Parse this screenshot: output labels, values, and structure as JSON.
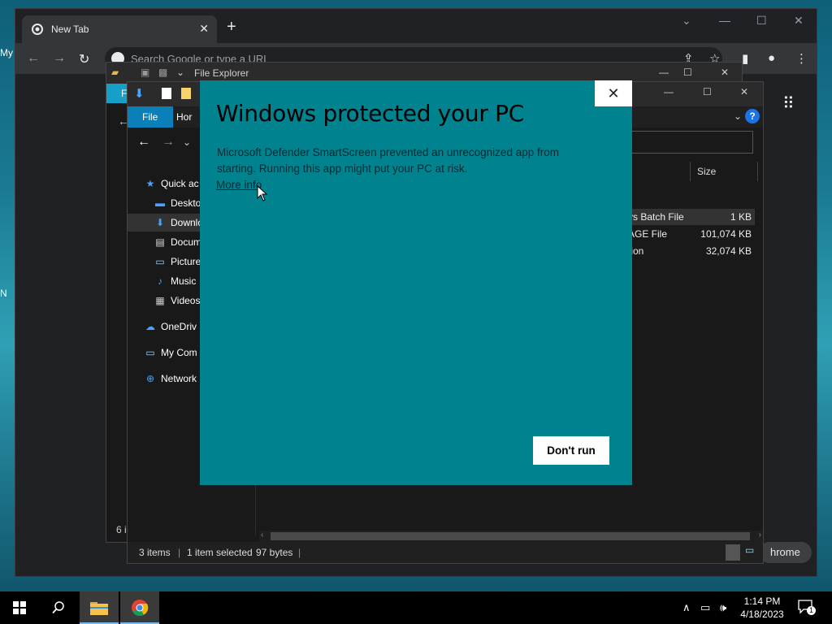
{
  "desktop": {
    "fragments": [
      "My",
      "N"
    ]
  },
  "chrome": {
    "tab_title": "New Tab",
    "tab_close": "✕",
    "new_tab": "+",
    "minimize": "—",
    "maximize": "☐",
    "close": "✕",
    "omnibox_placeholder": "Search Google or type a URL",
    "apps_label": "Apps",
    "bottom_button": "hrome"
  },
  "explorer_back": {
    "title": "File Explorer",
    "ribbon_tab": "F",
    "status": "6 i"
  },
  "explorer": {
    "ribbon_file": "File",
    "ribbon_home": "Hor",
    "help": "?",
    "sidebar": [
      {
        "label": "Quick ac",
        "icon": "star-icon"
      },
      {
        "label": "Deskto",
        "icon": "desktop-folder-icon"
      },
      {
        "label": "Downlo",
        "icon": "downloads-icon"
      },
      {
        "label": "Docum",
        "icon": "documents-icon"
      },
      {
        "label": "Picture",
        "icon": "pictures-icon"
      },
      {
        "label": "Music",
        "icon": "music-icon"
      },
      {
        "label": "Videos",
        "icon": "videos-icon"
      },
      {
        "label": "OneDriv",
        "icon": "onedrive-icon"
      },
      {
        "label": "My Com",
        "icon": "computer-icon"
      },
      {
        "label": "Network",
        "icon": "network-icon"
      }
    ],
    "column_size": "Size",
    "files": [
      {
        "type": "vs Batch File",
        "size": "1 KB"
      },
      {
        "type": "AGE File",
        "size": "101,074 KB"
      },
      {
        "type": "tion",
        "size": "32,074 KB"
      }
    ],
    "status_items": "3 items",
    "status_selected": "1 item selected",
    "status_bytes": "97 bytes"
  },
  "dialog": {
    "heading": "Windows protected your PC",
    "body": "Microsoft Defender SmartScreen prevented an unrecognized app from starting. Running this app might put your PC at risk.",
    "more_info": "More info",
    "dont_run": "Don't run",
    "close": "✕"
  },
  "taskbar": {
    "time": "1:14 PM",
    "date": "4/18/2023",
    "notification_count": "1"
  }
}
